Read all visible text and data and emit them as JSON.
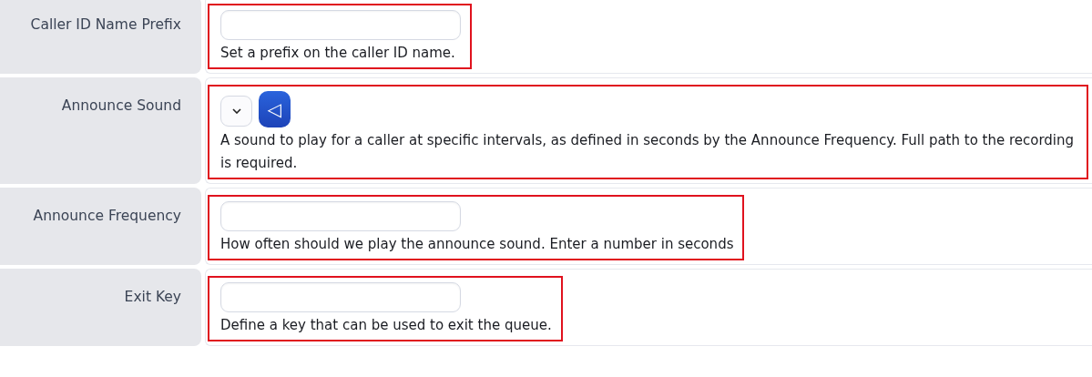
{
  "rows": [
    {
      "label": "Caller ID Name Prefix",
      "kind": "text",
      "highlighted": true,
      "help": "Set a prefix on the caller ID name."
    },
    {
      "label": "Announce Sound",
      "kind": "sound",
      "highlighted": true,
      "play_symbol": "◁",
      "help": "A sound to play for a caller at specific intervals, as defined in seconds by the Announce Frequency. Full path to the recording is required."
    },
    {
      "label": "Announce Frequency",
      "kind": "text",
      "highlighted": true,
      "help": "How often should we play the announce sound. Enter a number in seconds"
    },
    {
      "label": "Exit Key",
      "kind": "text",
      "highlighted": true,
      "help": "Define a key that can be used to exit the queue."
    }
  ]
}
